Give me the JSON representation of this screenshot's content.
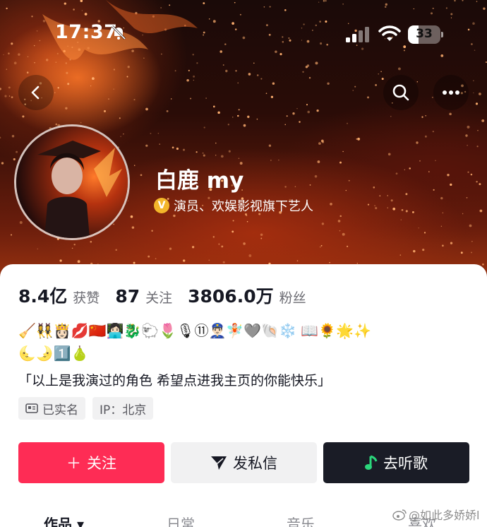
{
  "status_bar": {
    "time": "17:37",
    "battery": "33"
  },
  "profile": {
    "name": "白鹿 my",
    "verify_badge": "V",
    "verification": "演员、欢娱影视旗下艺人"
  },
  "stats": [
    {
      "value": "8.4亿",
      "label": "获赞"
    },
    {
      "value": "87",
      "label": "关注"
    },
    {
      "value": "3806.0万",
      "label": "粉丝"
    }
  ],
  "emoji_line_1": "🧹👯‍♀️👸🏻💋🇨🇳👩🏻‍💻🐉🐑🌷🎙⑪👮🏻‍♂️🧚🏻🩶🐚❄️ 📖🌻🌟✨",
  "emoji_line_2": "🌜🌛1️⃣🍐",
  "bio": "「以上是我演过的角色 希望点进我主页的你能快乐」",
  "tags": {
    "real_name": "已实名",
    "ip": "IP：北京"
  },
  "actions": {
    "follow": "关注",
    "follow_plus": "＋",
    "message": "发私信",
    "music": "去听歌"
  },
  "tabs": [
    "作品 ▾",
    "日常",
    "音乐",
    "喜欢"
  ],
  "watermark": "@如此多娇娇l",
  "icons": [
    "back-arrow-icon",
    "search-icon",
    "more-dots-icon",
    "bell-off-icon",
    "signal-icon",
    "wifi-icon",
    "id-card-icon",
    "paper-plane-icon",
    "music-note-icon",
    "weibo-icon"
  ],
  "colors": {
    "accent": "#fe2c55",
    "music_button": "#1a1c26",
    "secondary_button": "#f1f1f2",
    "verify_badge": "#f3b62a"
  }
}
